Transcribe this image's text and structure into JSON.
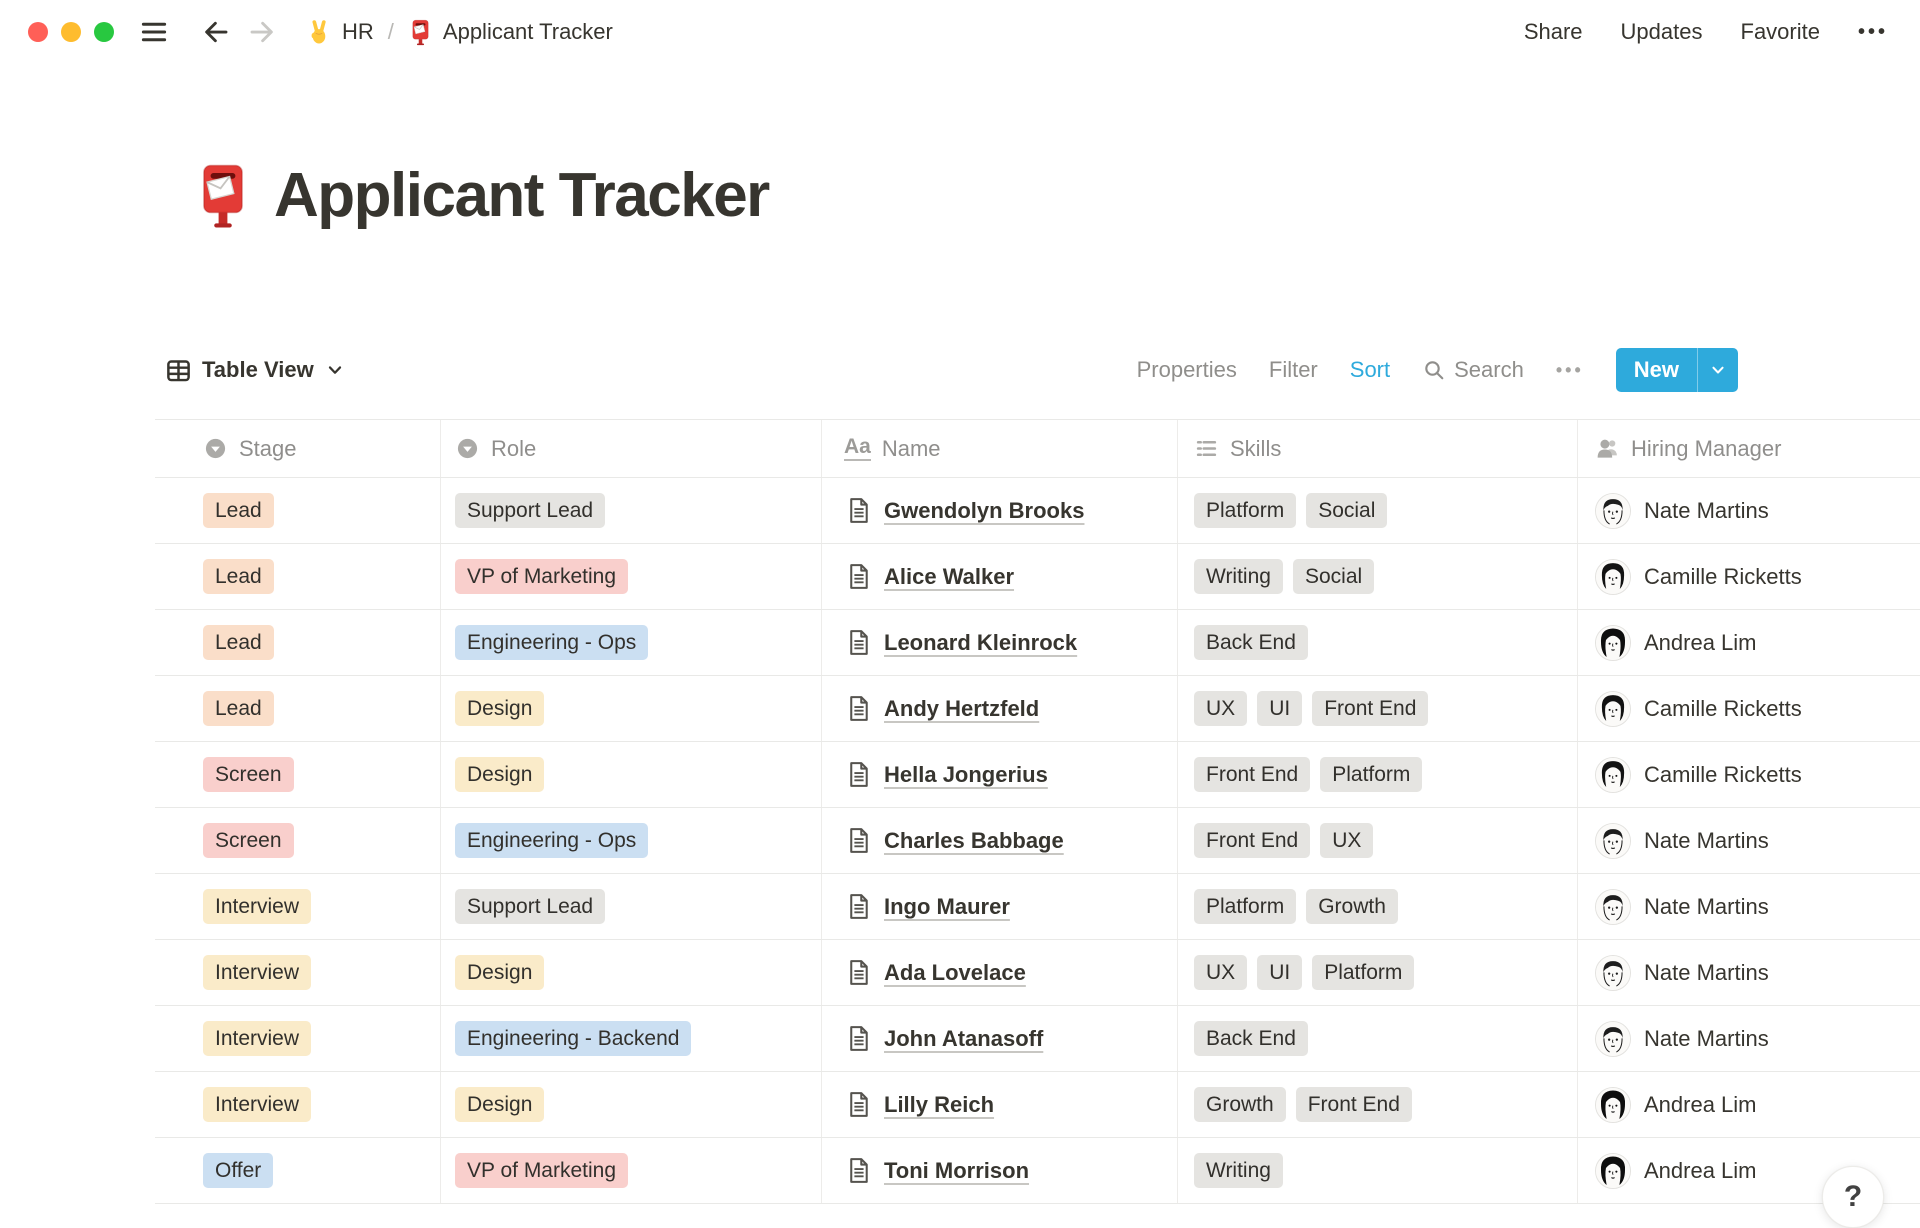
{
  "topbar": {
    "breadcrumb": {
      "workspace": "HR",
      "separator": "/",
      "page": "Applicant Tracker"
    },
    "share": "Share",
    "updates": "Updates",
    "favorite": "Favorite",
    "more": "•••"
  },
  "page": {
    "title": "Applicant Tracker",
    "emoji": "postbox"
  },
  "toolbar": {
    "view_label": "Table View",
    "properties": "Properties",
    "filter": "Filter",
    "sort": "Sort",
    "search": "Search",
    "more": "•••",
    "new_label": "New"
  },
  "table": {
    "columns": [
      {
        "label": "Stage",
        "type": "select",
        "icon": "select-icon"
      },
      {
        "label": "Role",
        "type": "select",
        "icon": "select-icon"
      },
      {
        "label": "Name",
        "type": "title",
        "icon": "Aa"
      },
      {
        "label": "Skills",
        "type": "multi-select",
        "icon": "list-icon"
      },
      {
        "label": "Hiring Manager",
        "type": "person",
        "icon": "person-icon"
      }
    ],
    "rows": [
      {
        "stage": {
          "label": "Lead",
          "color": "orange"
        },
        "role": {
          "label": "Support Lead",
          "color": "gray"
        },
        "name": "Gwendolyn Brooks",
        "skills": [
          "Platform",
          "Social"
        ],
        "manager": {
          "name": "Nate Martins",
          "avatar": "nate"
        }
      },
      {
        "stage": {
          "label": "Lead",
          "color": "orange"
        },
        "role": {
          "label": "VP of Marketing",
          "color": "red"
        },
        "name": "Alice Walker",
        "skills": [
          "Writing",
          "Social"
        ],
        "manager": {
          "name": "Camille Ricketts",
          "avatar": "camille"
        }
      },
      {
        "stage": {
          "label": "Lead",
          "color": "orange"
        },
        "role": {
          "label": "Engineering - Ops",
          "color": "blue"
        },
        "name": "Leonard Kleinrock",
        "skills": [
          "Back End"
        ],
        "manager": {
          "name": "Andrea Lim",
          "avatar": "andrea"
        }
      },
      {
        "stage": {
          "label": "Lead",
          "color": "orange"
        },
        "role": {
          "label": "Design",
          "color": "yellow"
        },
        "name": "Andy Hertzfeld",
        "skills": [
          "UX",
          "UI",
          "Front End"
        ],
        "manager": {
          "name": "Camille Ricketts",
          "avatar": "camille"
        }
      },
      {
        "stage": {
          "label": "Screen",
          "color": "red"
        },
        "role": {
          "label": "Design",
          "color": "yellow"
        },
        "name": "Hella Jongerius",
        "skills": [
          "Front End",
          "Platform"
        ],
        "manager": {
          "name": "Camille Ricketts",
          "avatar": "camille"
        }
      },
      {
        "stage": {
          "label": "Screen",
          "color": "red"
        },
        "role": {
          "label": "Engineering - Ops",
          "color": "blue"
        },
        "name": "Charles Babbage",
        "skills": [
          "Front End",
          "UX"
        ],
        "manager": {
          "name": "Nate Martins",
          "avatar": "nate"
        }
      },
      {
        "stage": {
          "label": "Interview",
          "color": "yellow"
        },
        "role": {
          "label": "Support Lead",
          "color": "gray"
        },
        "name": "Ingo Maurer",
        "skills": [
          "Platform",
          "Growth"
        ],
        "manager": {
          "name": "Nate Martins",
          "avatar": "nate"
        }
      },
      {
        "stage": {
          "label": "Interview",
          "color": "yellow"
        },
        "role": {
          "label": "Design",
          "color": "yellow"
        },
        "name": "Ada Lovelace",
        "skills": [
          "UX",
          "UI",
          "Platform"
        ],
        "manager": {
          "name": "Nate Martins",
          "avatar": "nate"
        }
      },
      {
        "stage": {
          "label": "Interview",
          "color": "yellow"
        },
        "role": {
          "label": "Engineering - Backend",
          "color": "blue"
        },
        "name": "John Atanasoff",
        "skills": [
          "Back End"
        ],
        "manager": {
          "name": "Nate Martins",
          "avatar": "nate"
        }
      },
      {
        "stage": {
          "label": "Interview",
          "color": "yellow"
        },
        "role": {
          "label": "Design",
          "color": "yellow"
        },
        "name": "Lilly Reich",
        "skills": [
          "Growth",
          "Front End"
        ],
        "manager": {
          "name": "Andrea Lim",
          "avatar": "andrea"
        }
      },
      {
        "stage": {
          "label": "Offer",
          "color": "blue"
        },
        "role": {
          "label": "VP of Marketing",
          "color": "red"
        },
        "name": "Toni Morrison",
        "skills": [
          "Writing"
        ],
        "manager": {
          "name": "Andrea Lim",
          "avatar": "andrea"
        }
      }
    ]
  },
  "help": {
    "label": "?"
  },
  "icons": {
    "title_property_glyph": "Aa",
    "page_emoji": "postbox-icon",
    "breadcrumb_emoji": "victory-hand-icon"
  },
  "colors": {
    "accent_blue": "#2EAADC",
    "text": "#37352F",
    "gray_text": "#8F8E8B",
    "border": "#E9E9E7",
    "tag_gray": "#E5E4E1",
    "tag_orange": "#FADEC9",
    "tag_red": "#F9CFCC",
    "tag_yellow": "#FAEBC9",
    "tag_blue": "#CBDFF2",
    "traffic_red": "#FF5F57",
    "traffic_yellow": "#FEBC2E",
    "traffic_green": "#28C840"
  }
}
